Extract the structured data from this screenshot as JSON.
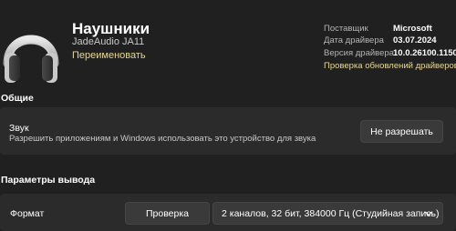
{
  "device": {
    "title": "Наушники",
    "model": "JadeAudio JA11",
    "rename_label": "Переименовать",
    "icon": "headphones-icon"
  },
  "driver_info": {
    "provider_label": "Поставщик",
    "provider_value": "Microsoft",
    "date_label": "Дата драйвера",
    "date_value": "03.07.2024",
    "version_label": "Версия драйвера",
    "version_value": "10.0.26100.1150",
    "update_link": "Проверка обновлений драйверов"
  },
  "general": {
    "heading": "Общие",
    "sound_title": "Звук",
    "sound_description": "Разрешить приложениям и Windows использовать это устройство для звука",
    "deny_button": "Не разрешать"
  },
  "output": {
    "heading": "Параметры вывода",
    "format_label": "Формат",
    "test_button": "Проверка",
    "format_value": "2 каналов, 32 бит, 384000 Гц (Студийная запись)",
    "chevron_icon": "chevron-down-icon"
  },
  "colors": {
    "background": "#202020",
    "card": "#2b2b2b",
    "button": "#3a3a3a",
    "accent_link": "#e6d79a"
  }
}
